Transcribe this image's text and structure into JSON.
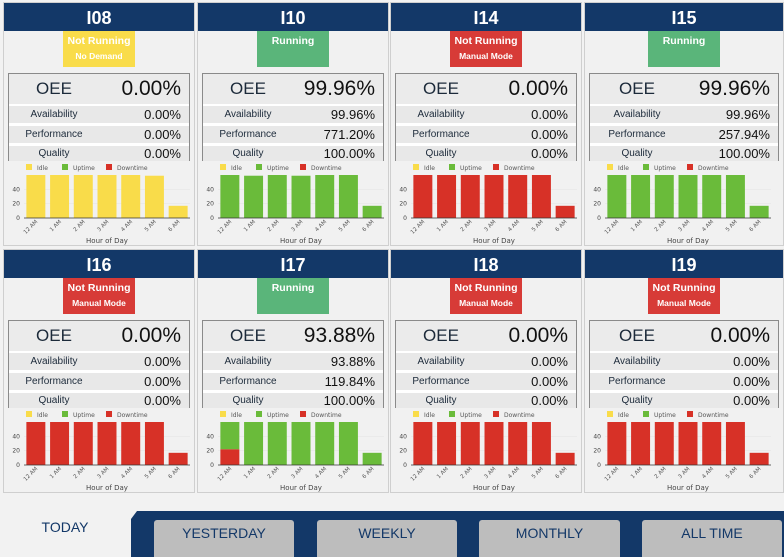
{
  "colors": {
    "header": "#133868",
    "idle": "#f9dc4a",
    "uptime": "#6abb3a",
    "downtime": "#d73127",
    "status_running": "#5ab57a",
    "status_not_running_manual": "#d73b37",
    "status_not_running_no_demand": "#f9dc4a"
  },
  "labels": {
    "oee": "OEE",
    "availability": "Availability",
    "performance": "Performance",
    "quality": "Quality"
  },
  "machines": [
    {
      "name": "I08",
      "status": "Not Running",
      "substatus": "No Demand",
      "status_type": "idle",
      "oee": "0.00%",
      "availability": "0.00%",
      "performance": "0.00%",
      "quality": "0.00%"
    },
    {
      "name": "I10",
      "status": "Running",
      "substatus": "",
      "status_type": "running",
      "oee": "99.96%",
      "availability": "99.96%",
      "performance": "771.20%",
      "quality": "100.00%"
    },
    {
      "name": "I14",
      "status": "Not Running",
      "substatus": "Manual Mode",
      "status_type": "manual",
      "oee": "0.00%",
      "availability": "0.00%",
      "performance": "0.00%",
      "quality": "0.00%"
    },
    {
      "name": "I15",
      "status": "Running",
      "substatus": "",
      "status_type": "running",
      "oee": "99.96%",
      "availability": "99.96%",
      "performance": "257.94%",
      "quality": "100.00%"
    },
    {
      "name": "I16",
      "status": "Not Running",
      "substatus": "Manual Mode",
      "status_type": "manual",
      "oee": "0.00%",
      "availability": "0.00%",
      "performance": "0.00%",
      "quality": "0.00%"
    },
    {
      "name": "I17",
      "status": "Running",
      "substatus": "",
      "status_type": "running",
      "oee": "93.88%",
      "availability": "93.88%",
      "performance": "119.84%",
      "quality": "100.00%"
    },
    {
      "name": "I18",
      "status": "Not Running",
      "substatus": "Manual Mode",
      "status_type": "manual",
      "oee": "0.00%",
      "availability": "0.00%",
      "performance": "0.00%",
      "quality": "0.00%"
    },
    {
      "name": "I19",
      "status": "Not Running",
      "substatus": "Manual Mode",
      "status_type": "manual",
      "oee": "0.00%",
      "availability": "0.00%",
      "performance": "0.00%",
      "quality": "0.00%"
    }
  ],
  "chart_data": [
    {
      "type": "bar",
      "stacked": true,
      "machine": "I08",
      "xlabel": "Hour of Day",
      "ylabel": "",
      "categories": [
        "12 AM",
        "1 AM",
        "2 AM",
        "3 AM",
        "4 AM",
        "5 AM",
        "6 AM"
      ],
      "yticks": [
        0,
        20,
        40
      ],
      "ylim": [
        0,
        60
      ],
      "legend": [
        "Idle",
        "Uptime",
        "Downtime"
      ],
      "legend_position": "top",
      "series": [
        {
          "name": "Idle",
          "values": [
            60,
            60,
            60,
            60,
            60,
            59,
            17
          ]
        },
        {
          "name": "Uptime",
          "values": [
            0,
            0,
            0,
            0,
            0,
            0,
            0
          ]
        },
        {
          "name": "Downtime",
          "values": [
            0,
            0,
            0,
            0,
            0,
            0,
            0
          ]
        }
      ]
    },
    {
      "type": "bar",
      "stacked": true,
      "machine": "I10",
      "xlabel": "Hour of Day",
      "ylabel": "",
      "categories": [
        "12 AM",
        "1 AM",
        "2 AM",
        "3 AM",
        "4 AM",
        "5 AM",
        "6 AM"
      ],
      "yticks": [
        0,
        20,
        40
      ],
      "ylim": [
        0,
        60
      ],
      "legend": [
        "Idle",
        "Uptime",
        "Downtime"
      ],
      "legend_position": "top",
      "series": [
        {
          "name": "Idle",
          "values": [
            0,
            0,
            0,
            0,
            0,
            0,
            0
          ]
        },
        {
          "name": "Uptime",
          "values": [
            60,
            59,
            60,
            59,
            60,
            60,
            17
          ]
        },
        {
          "name": "Downtime",
          "values": [
            0,
            0,
            0,
            0,
            0,
            0,
            0
          ]
        }
      ]
    },
    {
      "type": "bar",
      "stacked": true,
      "machine": "I14",
      "xlabel": "Hour of Day",
      "ylabel": "",
      "categories": [
        "12 AM",
        "1 AM",
        "2 AM",
        "3 AM",
        "4 AM",
        "5 AM",
        "6 AM"
      ],
      "yticks": [
        0,
        20,
        40
      ],
      "ylim": [
        0,
        60
      ],
      "legend": [
        "Idle",
        "Uptime",
        "Downtime"
      ],
      "legend_position": "top",
      "series": [
        {
          "name": "Idle",
          "values": [
            0,
            0,
            0,
            0,
            0,
            0,
            0
          ]
        },
        {
          "name": "Uptime",
          "values": [
            0,
            0,
            0,
            0,
            0,
            0,
            0
          ]
        },
        {
          "name": "Downtime",
          "values": [
            60,
            60,
            60,
            60,
            60,
            60,
            17
          ]
        }
      ]
    },
    {
      "type": "bar",
      "stacked": true,
      "machine": "I15",
      "xlabel": "Hour of Day",
      "ylabel": "",
      "categories": [
        "12 AM",
        "1 AM",
        "2 AM",
        "3 AM",
        "4 AM",
        "5 AM",
        "6 AM"
      ],
      "yticks": [
        0,
        20,
        40
      ],
      "ylim": [
        0,
        60
      ],
      "legend": [
        "Idle",
        "Uptime",
        "Downtime"
      ],
      "legend_position": "top",
      "series": [
        {
          "name": "Idle",
          "values": [
            0,
            0,
            0,
            0,
            0,
            0,
            0
          ]
        },
        {
          "name": "Uptime",
          "values": [
            60,
            60,
            60,
            60,
            60,
            60,
            17
          ]
        },
        {
          "name": "Downtime",
          "values": [
            0,
            0,
            0,
            0,
            0,
            0,
            0
          ]
        }
      ]
    },
    {
      "type": "bar",
      "stacked": true,
      "machine": "I16",
      "xlabel": "Hour of Day",
      "ylabel": "",
      "categories": [
        "12 AM",
        "1 AM",
        "2 AM",
        "3 AM",
        "4 AM",
        "5 AM",
        "6 AM"
      ],
      "yticks": [
        0,
        20,
        40
      ],
      "ylim": [
        0,
        60
      ],
      "legend": [
        "Idle",
        "Uptime",
        "Downtime"
      ],
      "legend_position": "top",
      "series": [
        {
          "name": "Idle",
          "values": [
            0,
            0,
            0,
            0,
            0,
            0,
            0
          ]
        },
        {
          "name": "Uptime",
          "values": [
            0,
            0,
            0,
            0,
            0,
            0,
            0
          ]
        },
        {
          "name": "Downtime",
          "values": [
            60,
            60,
            60,
            60,
            60,
            60,
            17
          ]
        }
      ]
    },
    {
      "type": "bar",
      "stacked": true,
      "machine": "I17",
      "xlabel": "Hour of Day",
      "ylabel": "",
      "categories": [
        "12 AM",
        "1 AM",
        "2 AM",
        "3 AM",
        "4 AM",
        "5 AM",
        "6 AM"
      ],
      "yticks": [
        0,
        20,
        40
      ],
      "ylim": [
        0,
        60
      ],
      "legend": [
        "Idle",
        "Uptime",
        "Downtime"
      ],
      "legend_position": "top",
      "series": [
        {
          "name": "Idle",
          "values": [
            0,
            0,
            0,
            0,
            0,
            0,
            0
          ]
        },
        {
          "name": "Uptime",
          "values": [
            38,
            60,
            60,
            60,
            60,
            60,
            17
          ]
        },
        {
          "name": "Downtime",
          "values": [
            22,
            0,
            0,
            0,
            0,
            0,
            0
          ]
        }
      ]
    },
    {
      "type": "bar",
      "stacked": true,
      "machine": "I18",
      "xlabel": "Hour of Day",
      "ylabel": "",
      "categories": [
        "12 AM",
        "1 AM",
        "2 AM",
        "3 AM",
        "4 AM",
        "5 AM",
        "6 AM"
      ],
      "yticks": [
        0,
        20,
        40
      ],
      "ylim": [
        0,
        60
      ],
      "legend": [
        "Idle",
        "Uptime",
        "Downtime"
      ],
      "legend_position": "top",
      "series": [
        {
          "name": "Idle",
          "values": [
            0,
            0,
            0,
            0,
            0,
            0,
            0
          ]
        },
        {
          "name": "Uptime",
          "values": [
            0,
            0,
            0,
            0,
            0,
            0,
            0
          ]
        },
        {
          "name": "Downtime",
          "values": [
            60,
            60,
            60,
            60,
            60,
            60,
            17
          ]
        }
      ]
    },
    {
      "type": "bar",
      "stacked": true,
      "machine": "I19",
      "xlabel": "Hour of Day",
      "ylabel": "",
      "categories": [
        "12 AM",
        "1 AM",
        "2 AM",
        "3 AM",
        "4 AM",
        "5 AM",
        "6 AM"
      ],
      "yticks": [
        0,
        20,
        40
      ],
      "ylim": [
        0,
        60
      ],
      "legend": [
        "Idle",
        "Uptime",
        "Downtime"
      ],
      "legend_position": "top",
      "series": [
        {
          "name": "Idle",
          "values": [
            0,
            0,
            0,
            0,
            0,
            0,
            0
          ]
        },
        {
          "name": "Uptime",
          "values": [
            0,
            0,
            0,
            0,
            0,
            0,
            0
          ]
        },
        {
          "name": "Downtime",
          "values": [
            60,
            60,
            60,
            60,
            60,
            60,
            17
          ]
        }
      ]
    }
  ],
  "tabs": [
    {
      "label": "TODAY",
      "active": true
    },
    {
      "label": "YESTERDAY",
      "active": false
    },
    {
      "label": "WEEKLY",
      "active": false
    },
    {
      "label": "MONTHLY",
      "active": false
    },
    {
      "label": "ALL TIME",
      "active": false
    }
  ]
}
